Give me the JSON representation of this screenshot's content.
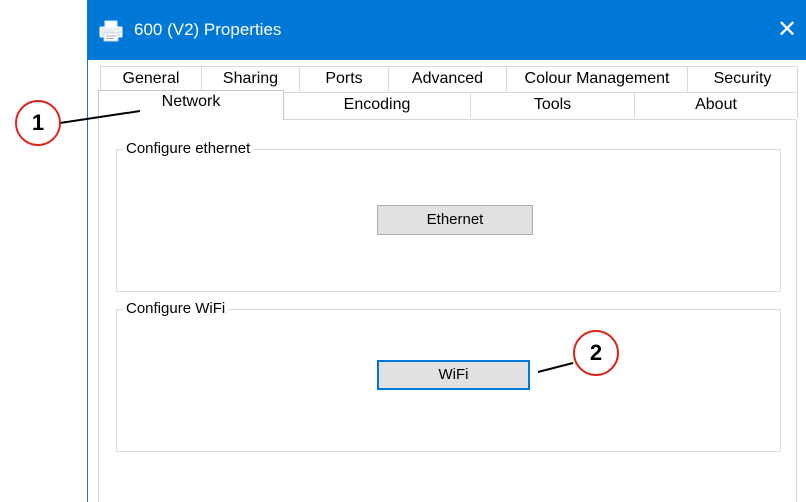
{
  "window": {
    "title": "600 (V2) Properties",
    "title_icon": "printer-icon",
    "close_glyph": "✕",
    "accent": "#0078d7"
  },
  "tabs": {
    "row1": [
      "General",
      "Sharing",
      "Ports",
      "Advanced",
      "Colour Management",
      "Security"
    ],
    "row2": [
      "Network",
      "Encoding",
      "Tools",
      "About"
    ],
    "active": "Network"
  },
  "groups": {
    "ethernet": {
      "legend": "Configure ethernet",
      "button_label": "Ethernet"
    },
    "wifi": {
      "legend": "Configure WiFi",
      "button_label": "WiFi"
    }
  },
  "callouts": {
    "one": "1",
    "two": "2",
    "color": "#d9261c"
  }
}
